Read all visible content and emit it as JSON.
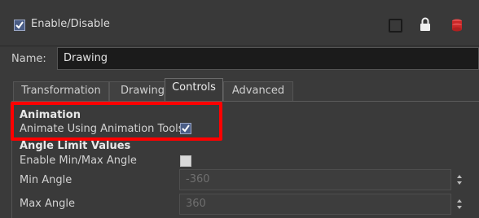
{
  "header": {
    "enable_label": "Enable/Disable",
    "enable_checked": true
  },
  "name": {
    "label": "Name:",
    "value": "Drawing"
  },
  "tabs": [
    {
      "label": "Transformation",
      "active": false
    },
    {
      "label": "Drawing",
      "active": false
    },
    {
      "label": "Controls",
      "active": true
    },
    {
      "label": "Advanced",
      "active": false
    }
  ],
  "animation": {
    "title": "Animation",
    "animate_label": "Animate Using Animation Tools",
    "animate_checked": true
  },
  "angle_limits": {
    "title": "Angle Limit Values",
    "enable_label": "Enable Min/Max Angle",
    "enable_checked": false,
    "min_label": "Min Angle",
    "min_value": "-360",
    "max_label": "Max Angle",
    "max_value": "360"
  },
  "icons": {
    "toggle": "square-outline-icon",
    "lock": "lock-icon",
    "layer": "layer-stack-icon"
  },
  "colors": {
    "highlight": "#ff0000",
    "checkbox_fill": "#4a5d86",
    "layer_icon": "#d02a2a"
  }
}
